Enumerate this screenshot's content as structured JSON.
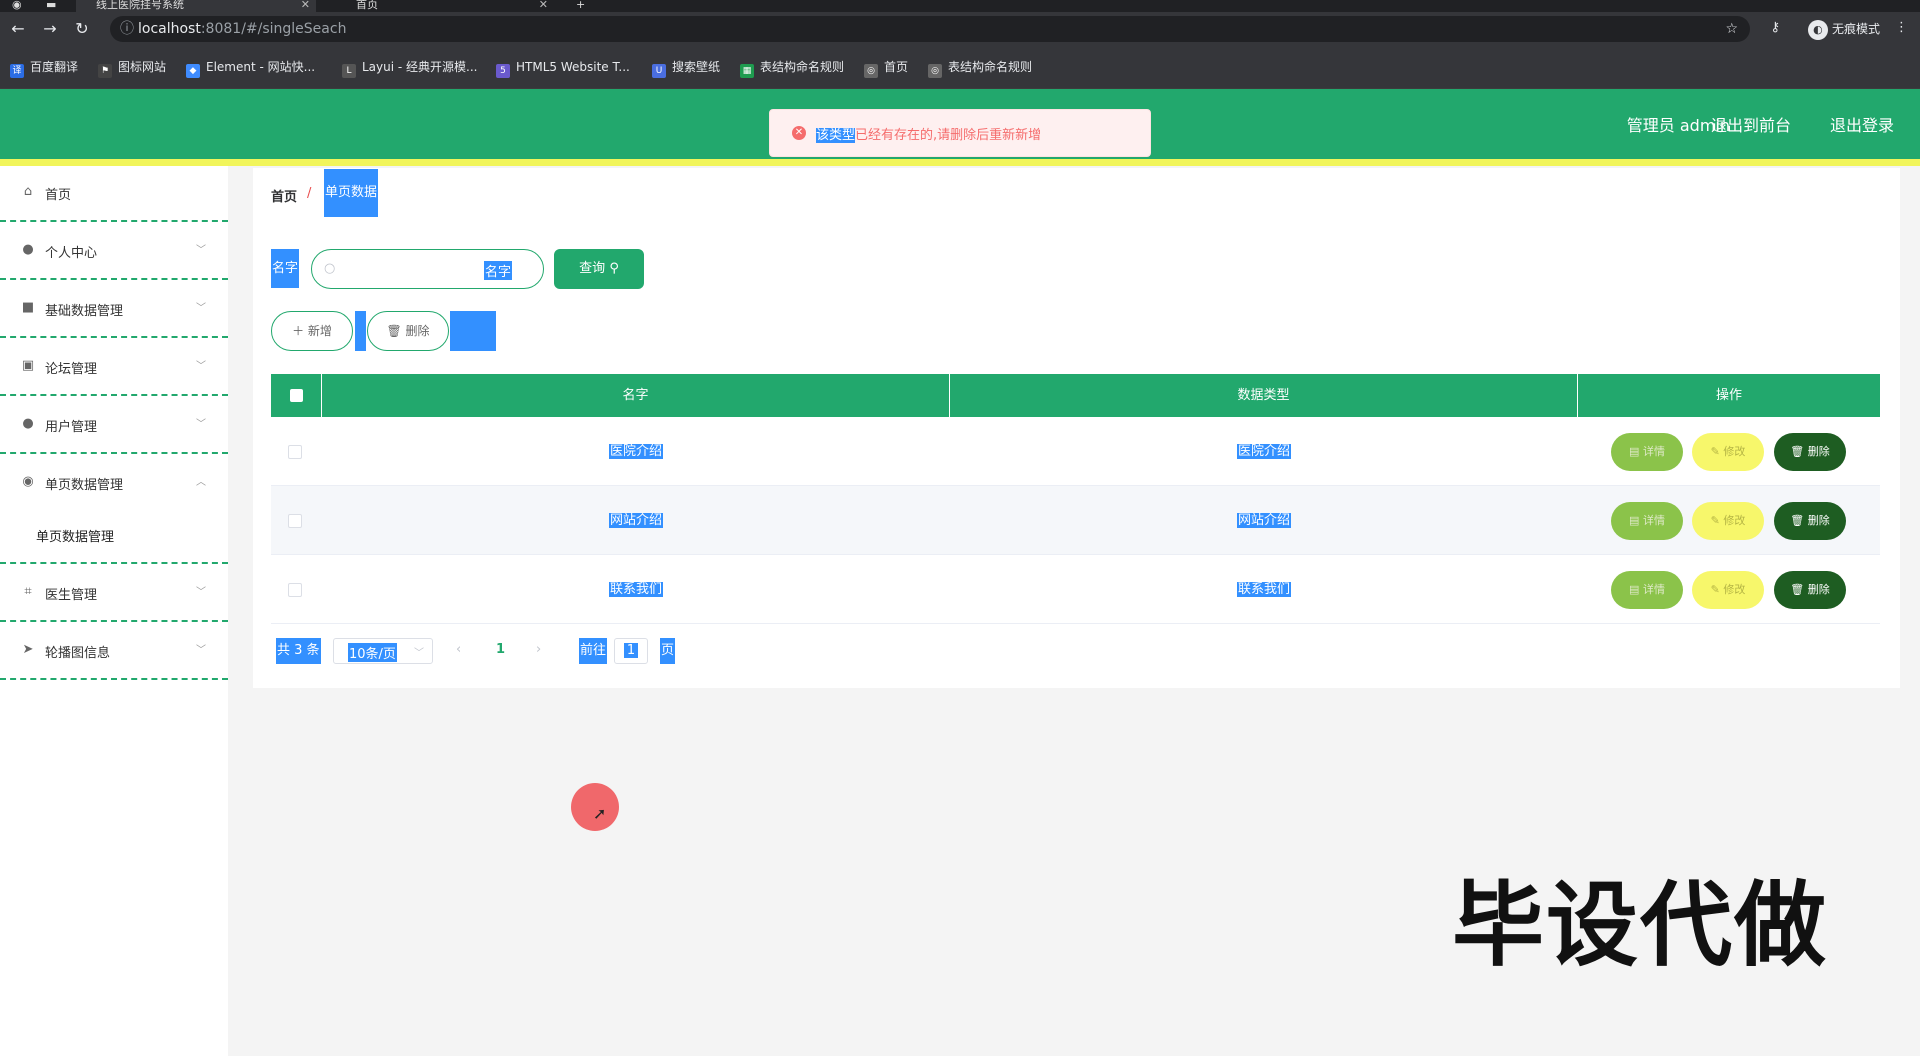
{
  "browser": {
    "tabs": [
      {
        "title": "线上医院挂号系统"
      },
      {
        "title": "首页"
      }
    ],
    "url_host": "localhost",
    "url_path": ":8081/#/singleSeach",
    "incognito_label": "无痕模式",
    "bookmarks": [
      {
        "label": "百度翻译",
        "color": "#2b6de5"
      },
      {
        "label": "图标网站",
        "color": "#444444"
      },
      {
        "label": "Element - 网站快...",
        "color": "#3f8cff"
      },
      {
        "label": "Layui - 经典开源模...",
        "color": "#555555"
      },
      {
        "label": "HTML5 Website T...",
        "color": "#6a5acd"
      },
      {
        "label": "搜索壁纸",
        "color": "#4a6ee0"
      },
      {
        "label": "表结构命名规则",
        "color": "#1e9c4f"
      },
      {
        "label": "首页",
        "color": "#666666"
      },
      {
        "label": "表结构命名规则",
        "color": "#666666"
      }
    ]
  },
  "header": {
    "admin_label": "管理员 admin",
    "back_label": "退出到前台",
    "logout_label": "退出登录",
    "color": "#22a86d"
  },
  "toast": {
    "highlight": "该类型",
    "message": "已经有存在的,请删除后重新新增"
  },
  "sidebar": {
    "items": [
      {
        "label": "首页",
        "icon": "home-icon"
      },
      {
        "label": "个人中心",
        "icon": "user-icon"
      },
      {
        "label": "基础数据管理",
        "icon": "video-icon"
      },
      {
        "label": "论坛管理",
        "icon": "box-icon"
      },
      {
        "label": "用户管理",
        "icon": "user-icon"
      },
      {
        "label": "单页数据管理",
        "icon": "location-icon"
      },
      {
        "label": "医生管理",
        "icon": "crop-icon"
      },
      {
        "label": "轮播图信息",
        "icon": "send-icon"
      }
    ],
    "submenu_label": "单页数据管理"
  },
  "breadcrumb": {
    "home": "首页",
    "separator": "/",
    "current": "单页数据"
  },
  "search": {
    "label": "名字",
    "placeholder": "名字",
    "button_label": "查询"
  },
  "actions": {
    "add_label": "新增",
    "delete_label": "删除"
  },
  "table": {
    "headers": [
      "名字",
      "数据类型",
      "操作"
    ],
    "rows": [
      {
        "name": "医院介绍",
        "type": "医院介绍"
      },
      {
        "name": "网站介绍",
        "type": "网站介绍"
      },
      {
        "name": "联系我们",
        "type": "联系我们"
      }
    ],
    "detail_label": "详情",
    "edit_label": "修改",
    "delete_label": "删除"
  },
  "pagination": {
    "total": "共 3 条",
    "page_size": "10条/页",
    "current_page": "1",
    "goto_label": "前往",
    "goto_value": "1",
    "page_suffix": "页"
  },
  "watermark": "毕设代做"
}
